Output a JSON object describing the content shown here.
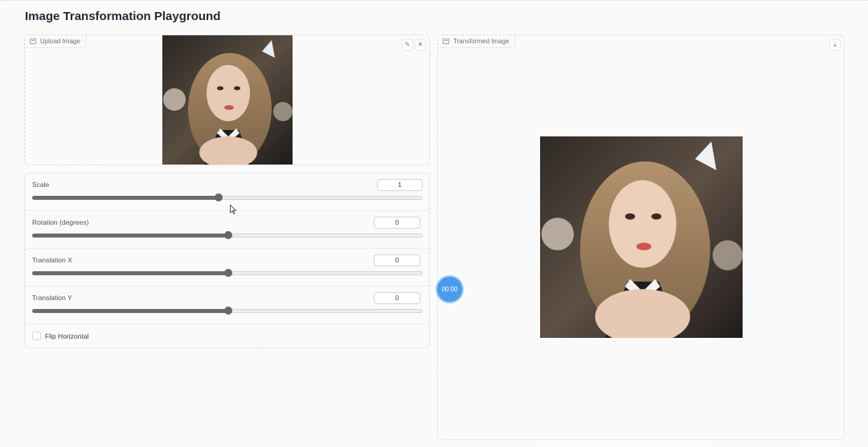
{
  "page": {
    "title": "Image Transformation Playground"
  },
  "upload_panel": {
    "label": "Upload Image",
    "icon": "image-icon",
    "edit_icon": "pencil-icon",
    "clear_icon": "close-icon"
  },
  "output_panel": {
    "label": "Transformed Image",
    "icon": "image-icon",
    "download_icon": "download-icon"
  },
  "controls": {
    "scale": {
      "label": "Scale",
      "value": "1",
      "fraction": 0.475
    },
    "rotation": {
      "label": "Rotation (degrees)",
      "value": "0",
      "fraction": 0.5
    },
    "translation_x": {
      "label": "Translation X",
      "value": "0",
      "fraction": 0.5
    },
    "translation_y": {
      "label": "Translation Y",
      "value": "0",
      "fraction": 0.5
    },
    "flip": {
      "label": "Flip Horizontal",
      "checked": false
    }
  },
  "timer": {
    "text": "00:00"
  }
}
